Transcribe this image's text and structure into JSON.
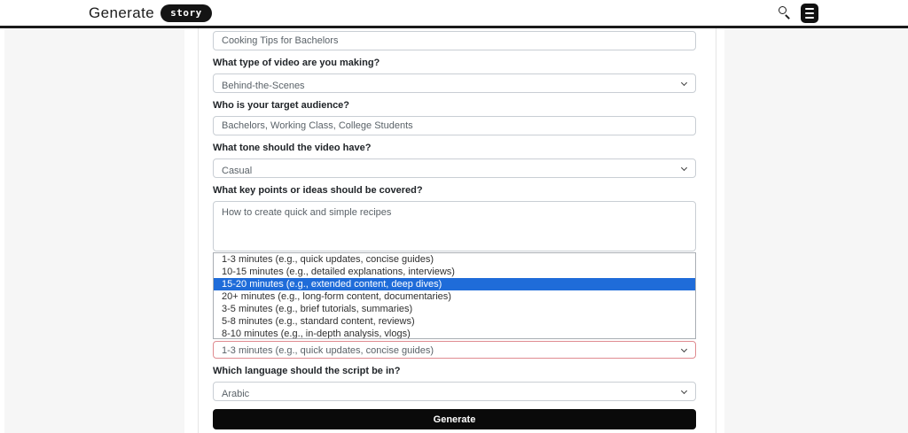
{
  "header": {
    "title": "Generate",
    "badge": "story",
    "icons": {
      "search": "search-icon",
      "journal": "journal-icon"
    }
  },
  "form": {
    "topic": {
      "value": "Cooking Tips for Bachelors"
    },
    "video_type": {
      "label": "What type of video are you making?",
      "value": "Behind-the-Scenes"
    },
    "audience": {
      "label": "Who is your target audience?",
      "value": "Bachelors, Working Class, College Students"
    },
    "tone": {
      "label": "What tone should the video have?",
      "value": "Casual"
    },
    "key_points": {
      "label": "What key points or ideas should be covered?",
      "value": "How to create quick and simple recipes"
    },
    "duration": {
      "options": [
        "1-3 minutes (e.g., quick updates, concise guides)",
        "10-15 minutes (e.g., detailed explanations, interviews)",
        "15-20 minutes (e.g., extended content, deep dives)",
        "20+ minutes (e.g., long-form content, documentaries)",
        "3-5 minutes (e.g., brief tutorials, summaries)",
        "5-8 minutes (e.g., standard content, reviews)",
        "8-10 minutes (e.g., in-depth analysis, vlogs)"
      ],
      "selected_index": 2,
      "value": "1-3 minutes (e.g., quick updates, concise guides)"
    },
    "language": {
      "label": "Which language should the script be in?",
      "value": "Arabic"
    },
    "generate_label": "Generate"
  },
  "colors": {
    "highlight_blue": "#1f6cd9",
    "invalid_border": "#df8b90",
    "button_black": "#0a0a0a",
    "panel_gray": "#f6f6f6"
  }
}
